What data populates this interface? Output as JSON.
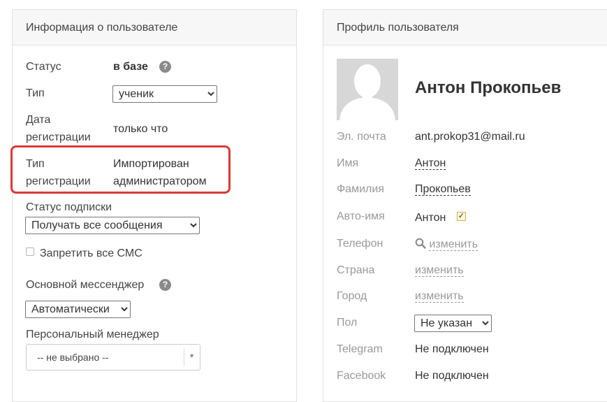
{
  "user_info": {
    "title": "Информация о пользователе",
    "status_label": "Статус",
    "status_value": "в базе",
    "help_glyph": "?",
    "type_label": "Тип",
    "type_selected": "ученик",
    "reg_date_label_1": "Дата",
    "reg_date_label_2": "регистрации",
    "reg_date_value": "только что",
    "reg_type_label_1": "Тип",
    "reg_type_label_2": "регистрации",
    "reg_type_value_1": "Импортирован",
    "reg_type_value_2": "администратором",
    "subscription_label": "Статус подписки",
    "subscription_selected": "Получать все сообщения",
    "block_sms_label": "Запретить все СМС",
    "block_sms_checked": false,
    "messenger_label": "Основной мессенджер",
    "messenger_selected": "Автоматически",
    "manager_label": "Персональный менеджер",
    "manager_selected": "-- не выбрано --",
    "highlight_color": "#d93a3a"
  },
  "profile": {
    "title": "Профиль пользователя",
    "full_name": "Антон Прокопьев",
    "email_label": "Эл. почта",
    "email_value": "ant.prokop31@mail.ru",
    "first_name_label": "Имя",
    "first_name_value": "Антон",
    "last_name_label": "Фамилия",
    "last_name_value": "Прокопьев",
    "autoname_label": "Авто-имя",
    "autoname_value": "Антон",
    "autoname_checked": true,
    "phone_label": "Телефон",
    "phone_link": "изменить",
    "country_label": "Страна",
    "country_link": "изменить",
    "city_label": "Город",
    "city_link": "изменить",
    "gender_label": "Пол",
    "gender_selected": "Не указан",
    "telegram_label": "Telegram",
    "telegram_value": "Не подключен",
    "facebook_label": "Facebook",
    "facebook_value": "Не подключен"
  }
}
